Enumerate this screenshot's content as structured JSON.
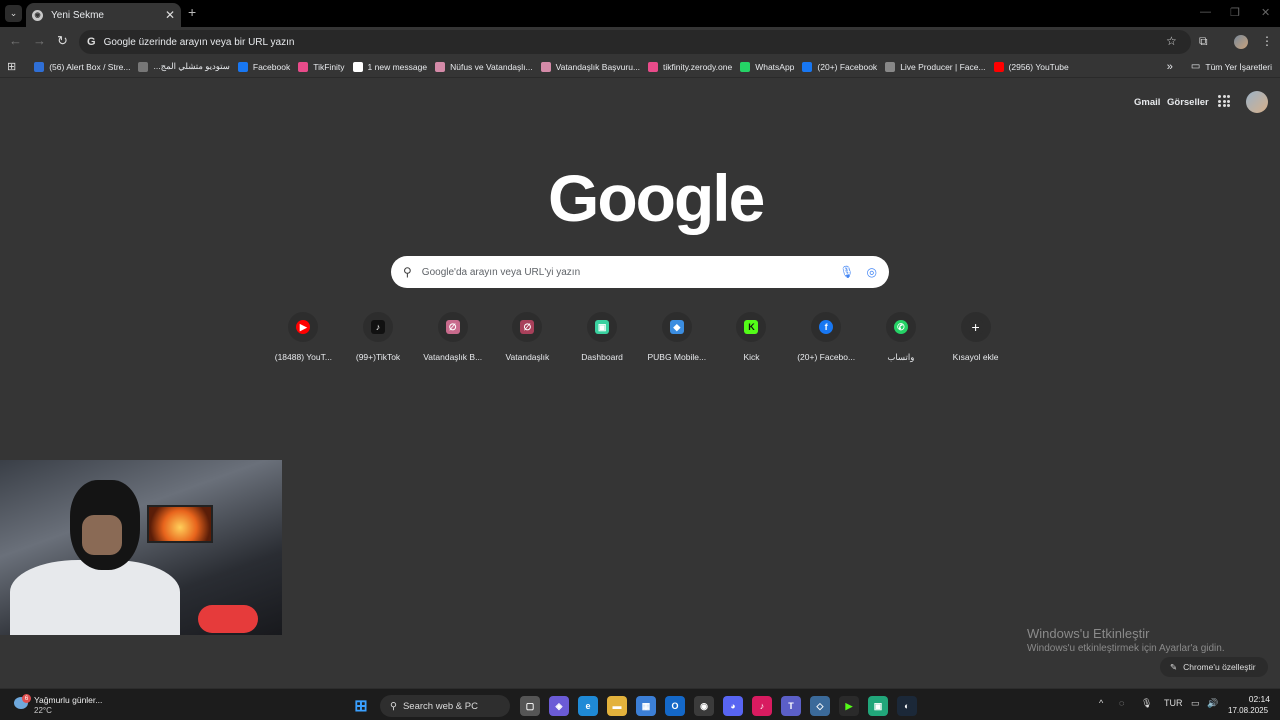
{
  "browser": {
    "tab_title": "Yeni Sekme",
    "close_glyph": "✕",
    "new_tab_glyph": "+",
    "omnibox_text": "Google üzerinde arayın veya bir URL yazın"
  },
  "bookmarks": [
    {
      "label": "(56) Alert Box / Stre...",
      "icon": "bookmark-icon",
      "color": "#2f6fd6"
    },
    {
      "label": "...ستوديو متشلي المج",
      "icon": "bookmark-icon",
      "color": "#777777"
    },
    {
      "label": "Facebook",
      "icon": "facebook-icon",
      "color": "#1877f2"
    },
    {
      "label": "TikFinity",
      "icon": "tikfinity-icon",
      "color": "#e94b8a"
    },
    {
      "label": "1 new message",
      "icon": "message-icon",
      "color": "#ffffff"
    },
    {
      "label": "Nüfus ve Vatandaşlı...",
      "icon": "feather-icon",
      "color": "#d48aa8"
    },
    {
      "label": "Vatandaşlık Başvuru...",
      "icon": "feather-icon",
      "color": "#d48aa8"
    },
    {
      "label": "tikfinity.zerody.one",
      "icon": "tikfinity-icon",
      "color": "#e94b8a"
    },
    {
      "label": "WhatsApp",
      "icon": "whatsapp-icon",
      "color": "#25d366"
    },
    {
      "label": "(20+) Facebook",
      "icon": "facebook-icon",
      "color": "#1877f2"
    },
    {
      "label": "Live Producer | Face...",
      "icon": "bookmark-icon",
      "color": "#888888"
    },
    {
      "label": "(2956) YouTube",
      "icon": "youtube-icon",
      "color": "#ff0000"
    }
  ],
  "bookmarks_more": "»",
  "all_bookmarks": "Tüm Yer İşaretleri",
  "google": {
    "gmail": "Gmail",
    "images": "Görseller",
    "logo": "Google",
    "search_placeholder": "Google'da arayın veya URL'yi yazın"
  },
  "shortcuts": [
    {
      "label": "(18488) YouT...",
      "icon": "youtube-icon",
      "color": "#ff0000",
      "glyph": "▶"
    },
    {
      "label": "(99+)TikTok",
      "icon": "tiktok-icon",
      "color": "#111111",
      "glyph": "♪"
    },
    {
      "label": "Vatandaşlık B...",
      "icon": "feather-icon",
      "color": "#c86a8c",
      "glyph": "∅"
    },
    {
      "label": "Vatandaşlık",
      "icon": "feather-icon",
      "color": "#a8405a",
      "glyph": "∅"
    },
    {
      "label": "Dashboard",
      "icon": "dashboard-icon",
      "color": "#3ad1a0",
      "glyph": "▣"
    },
    {
      "label": "PUBG Mobile...",
      "icon": "pubg-icon",
      "color": "#3b8de0",
      "glyph": "◆"
    },
    {
      "label": "Kick",
      "icon": "kick-icon",
      "color": "#53fc18",
      "glyph": "K"
    },
    {
      "label": "(20+) Facebo...",
      "icon": "facebook-icon",
      "color": "#1877f2",
      "glyph": "f"
    },
    {
      "label": "واتساب",
      "icon": "whatsapp-icon",
      "color": "#25d366",
      "glyph": "✆"
    },
    {
      "label": "Kısayol ekle",
      "icon": "add-icon",
      "color": "#2d2d2d",
      "glyph": "+"
    }
  ],
  "watermark": {
    "title": "Windows'u Etkinleştir",
    "subtitle": "Windows'u etkinleştirmek için Ayarlar'a gidin."
  },
  "customize_label": "Chrome'u özelleştir",
  "taskbar": {
    "weather_badge": "6",
    "weather_text": "Yağmurlu günler...",
    "temperature": "22°C",
    "search_label": "Search web & PC",
    "language": "TUR",
    "time": "02:14",
    "date": "17.08.2025"
  }
}
